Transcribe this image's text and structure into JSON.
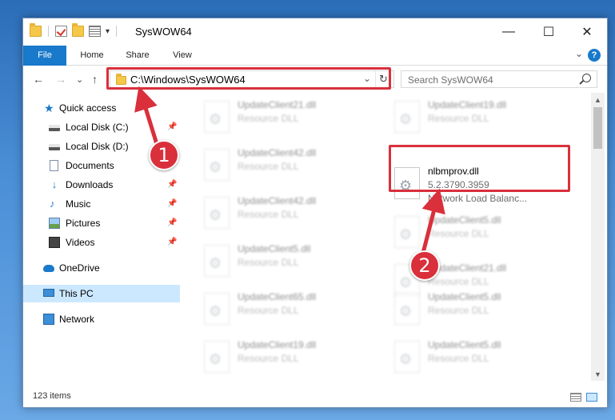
{
  "window": {
    "title": "SysWOW64",
    "qat_dropdown": "▾",
    "controls": {
      "minimize": "—",
      "maximize": "☐",
      "close": "✕"
    }
  },
  "ribbon": {
    "tabs": [
      "File",
      "Home",
      "Share",
      "View"
    ],
    "help": "?",
    "collapse": "⌄"
  },
  "toolbar": {
    "back": "←",
    "forward": "→",
    "recent": "⌄",
    "up": "↑",
    "address": "C:\\Windows\\SysWOW64",
    "address_dropdown": "⌄",
    "refresh": "↻",
    "search_placeholder": "Search SysWOW64"
  },
  "navpane": {
    "items": [
      {
        "label": "Quick access",
        "icon": "quick-access-star-icon"
      },
      {
        "label": "Local Disk (C:)",
        "icon": "drive-icon",
        "pinned": true
      },
      {
        "label": "Local Disk (D:)",
        "icon": "drive-icon"
      },
      {
        "label": "Documents",
        "icon": "documents-icon"
      },
      {
        "label": "Downloads",
        "icon": "downloads-icon",
        "pinned": true
      },
      {
        "label": "Music",
        "icon": "music-icon",
        "pinned": true
      },
      {
        "label": "Pictures",
        "icon": "pictures-icon",
        "pinned": true
      },
      {
        "label": "Videos",
        "icon": "videos-icon",
        "pinned": true
      },
      {
        "label": "OneDrive",
        "icon": "onedrive-icon"
      },
      {
        "label": "This PC",
        "icon": "this-pc-icon",
        "selected": true
      },
      {
        "label": "Network",
        "icon": "network-icon"
      }
    ],
    "pin_glyph": "📌"
  },
  "files": [
    {
      "name": "UpdateClient21.dll",
      "line2": "Resource DLL",
      "line3": "",
      "blurred": true
    },
    {
      "name": "UpdateClient19.dll",
      "line2": "Resource DLL",
      "line3": "",
      "blurred": true
    },
    {
      "name": "UpdateClient42.dll",
      "line2": "Resource DLL",
      "line3": "",
      "blurred": true
    },
    {
      "name": "nlbmprov.dll",
      "line2": "5.2.3790.3959",
      "line3": "Network Load Balanc...",
      "blurred": false
    },
    {
      "name": "UpdateClient42.dll",
      "line2": "Resource DLL",
      "line3": "",
      "blurred": true
    },
    {
      "name": "UpdateClient5.dll",
      "line2": "Resource DLL",
      "line3": "",
      "blurred": true
    },
    {
      "name": "UpdateClient5.dll",
      "line2": "Resource DLL",
      "line3": "",
      "blurred": true
    },
    {
      "name": "UpdateClient21.dll",
      "line2": "Resource DLL",
      "line3": "",
      "blurred": true
    },
    {
      "name": "UpdateClient65.dll",
      "line2": "Resource DLL",
      "line3": "",
      "blurred": true
    },
    {
      "name": "UpdateClient5.dll",
      "line2": "Resource DLL",
      "line3": "",
      "blurred": true
    },
    {
      "name": "UpdateClient19.dll",
      "line2": "Resource DLL",
      "line3": "",
      "blurred": true
    },
    {
      "name": "UpdateClient5.dll",
      "line2": "Resource DLL",
      "line3": "",
      "blurred": true
    }
  ],
  "scrollbar": {
    "up": "▲",
    "down": "▼"
  },
  "status": {
    "item_count": "123 items"
  },
  "callouts": [
    "1",
    "2"
  ],
  "colors": {
    "accent": "#1979ca",
    "highlight": "#d9303c",
    "selected_bg": "#cce8ff"
  }
}
